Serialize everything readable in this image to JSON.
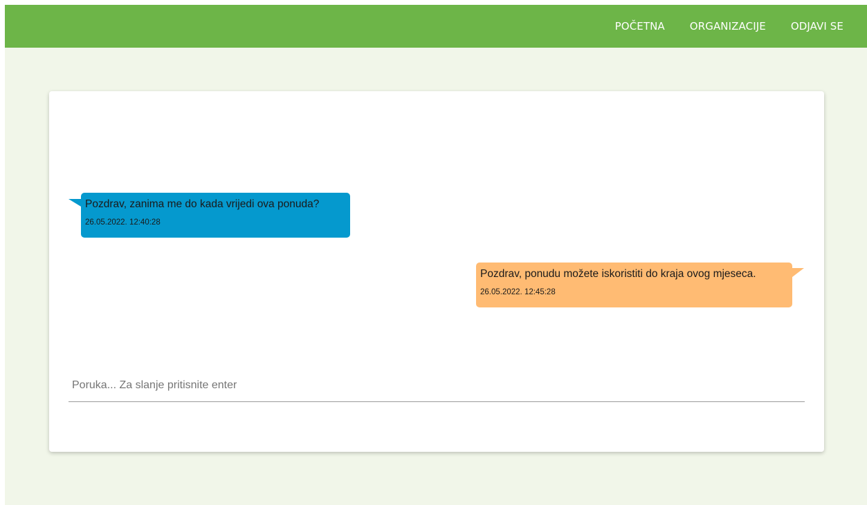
{
  "nav": {
    "items": [
      {
        "label": "POČETNA"
      },
      {
        "label": "ORGANIZACIJE"
      },
      {
        "label": "ODJAVI SE"
      }
    ]
  },
  "chat": {
    "messages": [
      {
        "text": "Pozdrav, zanima me do kada vrijedi ova ponuda?",
        "time": "26.05.2022. 12:40:28"
      },
      {
        "text": "Pozdrav, ponudu možete iskoristiti do kraja ovog mjeseca.",
        "time": "26.05.2022. 12:45:28"
      }
    ],
    "input": {
      "placeholder": "Poruka... Za slanje pritisnite enter",
      "value": ""
    }
  },
  "colors": {
    "navbar": "#6db548",
    "page_background": "#f1f6e9",
    "incoming_bubble": "#0599ce",
    "outgoing_bubble": "#ffbb73"
  }
}
